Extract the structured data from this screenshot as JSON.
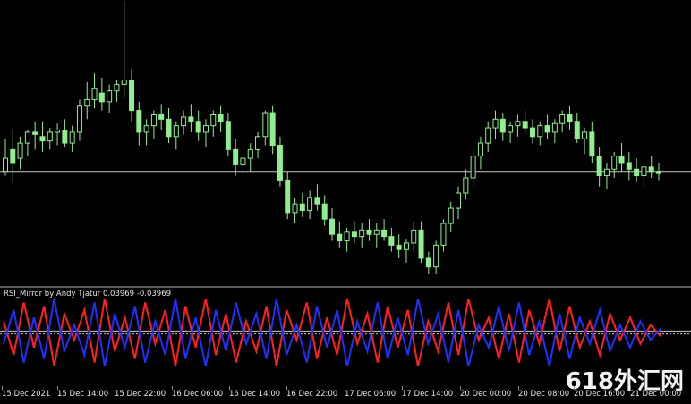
{
  "indicator": {
    "label": "RSI_Mirror by Andy Tjatur 0.03969 -0.03969"
  },
  "time_axis": {
    "labels": [
      "15 Dec 2021",
      "15 Dec 14:00",
      "15 Dec 22:00",
      "16 Dec 06:00",
      "16 Dec 14:00",
      "16 Dec 22:00",
      "17 Dec 06:00",
      "17 Dec 14:00",
      "20 Dec 00:00",
      "20 Dec 08:00",
      "20 Dec 16:00",
      "21 Dec 00:00"
    ]
  },
  "watermark": "618外汇网",
  "colors": {
    "background": "#000000",
    "candle": "#90ee90",
    "rsi_up": "#ff2020",
    "rsi_down": "#2030ff",
    "level_line": "#c8c8c8"
  },
  "chart_data": {
    "type": "candlestick",
    "candles": [
      [
        0.604,
        0.634,
        0.6,
        0.616
      ],
      [
        0.624,
        0.642,
        0.594,
        0.612
      ],
      [
        0.616,
        0.636,
        0.606,
        0.63
      ],
      [
        0.63,
        0.642,
        0.618,
        0.64
      ],
      [
        0.64,
        0.65,
        0.624,
        0.638
      ],
      [
        0.636,
        0.65,
        0.622,
        0.632
      ],
      [
        0.632,
        0.644,
        0.624,
        0.64
      ],
      [
        0.64,
        0.648,
        0.628,
        0.642
      ],
      [
        0.642,
        0.652,
        0.626,
        0.63
      ],
      [
        0.63,
        0.646,
        0.622,
        0.64
      ],
      [
        0.64,
        0.67,
        0.632,
        0.664
      ],
      [
        0.664,
        0.686,
        0.652,
        0.67
      ],
      [
        0.67,
        0.694,
        0.662,
        0.68
      ],
      [
        0.676,
        0.69,
        0.66,
        0.668
      ],
      [
        0.668,
        0.684,
        0.658,
        0.678
      ],
      [
        0.678,
        0.688,
        0.668,
        0.684
      ],
      [
        0.684,
        0.76,
        0.672,
        0.688
      ],
      [
        0.688,
        0.698,
        0.65,
        0.66
      ],
      [
        0.66,
        0.668,
        0.628,
        0.64
      ],
      [
        0.64,
        0.652,
        0.628,
        0.646
      ],
      [
        0.646,
        0.66,
        0.634,
        0.656
      ],
      [
        0.656,
        0.666,
        0.642,
        0.652
      ],
      [
        0.652,
        0.662,
        0.63,
        0.636
      ],
      [
        0.636,
        0.65,
        0.624,
        0.646
      ],
      [
        0.646,
        0.66,
        0.638,
        0.654
      ],
      [
        0.654,
        0.666,
        0.64,
        0.65
      ],
      [
        0.65,
        0.66,
        0.632,
        0.64
      ],
      [
        0.64,
        0.652,
        0.626,
        0.646
      ],
      [
        0.646,
        0.66,
        0.636,
        0.656
      ],
      [
        0.656,
        0.664,
        0.64,
        0.65
      ],
      [
        0.65,
        0.658,
        0.618,
        0.624
      ],
      [
        0.624,
        0.634,
        0.6,
        0.61
      ],
      [
        0.61,
        0.622,
        0.596,
        0.616
      ],
      [
        0.616,
        0.63,
        0.604,
        0.624
      ],
      [
        0.624,
        0.64,
        0.616,
        0.636
      ],
      [
        0.636,
        0.66,
        0.628,
        0.658
      ],
      [
        0.658,
        0.664,
        0.62,
        0.628
      ],
      [
        0.628,
        0.636,
        0.59,
        0.596
      ],
      [
        0.596,
        0.604,
        0.56,
        0.566
      ],
      [
        0.566,
        0.58,
        0.556,
        0.574
      ],
      [
        0.574,
        0.584,
        0.562,
        0.568
      ],
      [
        0.568,
        0.586,
        0.56,
        0.58
      ],
      [
        0.58,
        0.592,
        0.568,
        0.574
      ],
      [
        0.574,
        0.582,
        0.554,
        0.56
      ],
      [
        0.56,
        0.57,
        0.54,
        0.546
      ],
      [
        0.546,
        0.558,
        0.534,
        0.54
      ],
      [
        0.54,
        0.552,
        0.53,
        0.548
      ],
      [
        0.548,
        0.558,
        0.538,
        0.544
      ],
      [
        0.544,
        0.556,
        0.534,
        0.55
      ],
      [
        0.55,
        0.56,
        0.54,
        0.546
      ],
      [
        0.546,
        0.556,
        0.534,
        0.55
      ],
      [
        0.55,
        0.56,
        0.54,
        0.544
      ],
      [
        0.544,
        0.552,
        0.53,
        0.536
      ],
      [
        0.536,
        0.546,
        0.524,
        0.532
      ],
      [
        0.532,
        0.542,
        0.52,
        0.538
      ],
      [
        0.538,
        0.558,
        0.53,
        0.55
      ],
      [
        0.55,
        0.558,
        0.52,
        0.524
      ],
      [
        0.524,
        0.53,
        0.51,
        0.516
      ],
      [
        0.516,
        0.54,
        0.51,
        0.536
      ],
      [
        0.536,
        0.56,
        0.53,
        0.556
      ],
      [
        0.556,
        0.576,
        0.548,
        0.57
      ],
      [
        0.57,
        0.59,
        0.56,
        0.584
      ],
      [
        0.584,
        0.606,
        0.578,
        0.598
      ],
      [
        0.598,
        0.626,
        0.59,
        0.618
      ],
      [
        0.618,
        0.636,
        0.606,
        0.63
      ],
      [
        0.63,
        0.65,
        0.622,
        0.644
      ],
      [
        0.644,
        0.66,
        0.634,
        0.652
      ],
      [
        0.652,
        0.658,
        0.632,
        0.64
      ],
      [
        0.64,
        0.65,
        0.63,
        0.646
      ],
      [
        0.646,
        0.656,
        0.636,
        0.65
      ],
      [
        0.65,
        0.66,
        0.638,
        0.644
      ],
      [
        0.644,
        0.652,
        0.63,
        0.636
      ],
      [
        0.636,
        0.65,
        0.628,
        0.646
      ],
      [
        0.646,
        0.656,
        0.634,
        0.64
      ],
      [
        0.64,
        0.652,
        0.63,
        0.648
      ],
      [
        0.648,
        0.66,
        0.64,
        0.656
      ],
      [
        0.656,
        0.664,
        0.642,
        0.65
      ],
      [
        0.65,
        0.658,
        0.63,
        0.634
      ],
      [
        0.634,
        0.644,
        0.62,
        0.64
      ],
      [
        0.64,
        0.65,
        0.612,
        0.618
      ],
      [
        0.618,
        0.626,
        0.59,
        0.6
      ],
      [
        0.6,
        0.612,
        0.588,
        0.606
      ],
      [
        0.606,
        0.622,
        0.598,
        0.618
      ],
      [
        0.618,
        0.63,
        0.604,
        0.612
      ],
      [
        0.612,
        0.622,
        0.596,
        0.606
      ],
      [
        0.606,
        0.616,
        0.594,
        0.6
      ],
      [
        0.6,
        0.612,
        0.59,
        0.608
      ],
      [
        0.608,
        0.618,
        0.598,
        0.604
      ],
      [
        0.604,
        0.612,
        0.596,
        0.602
      ]
    ],
    "level_line": 0.604,
    "rsi_mirror": {
      "levels": [
        0.03969,
        -0.03969
      ],
      "series": [
        {
          "name": "up",
          "values": [
            0.3,
            -0.6,
            0.8,
            -0.4,
            0.7,
            -0.9,
            0.5,
            -0.2,
            0.6,
            -0.8,
            0.9,
            -0.5,
            0.4,
            -0.7,
            0.8,
            -0.3,
            0.6,
            -0.9,
            0.7,
            -0.4,
            0.9,
            -0.6,
            0.5,
            -0.8,
            0.3,
            -0.5,
            0.7,
            -0.9,
            0.6,
            -0.2,
            0.8,
            -0.7,
            0.4,
            -0.6,
            0.9,
            -0.3,
            0.5,
            -0.8,
            0.7,
            -0.4,
            0.6,
            -0.9,
            0.3,
            -0.5,
            0.8,
            -0.6,
            0.9,
            -0.2,
            0.4,
            -0.7,
            0.5,
            -0.8,
            0.6,
            -0.3,
            0.9,
            -0.5,
            0.7,
            -0.4,
            0.3,
            -0.6,
            0.5,
            -0.2,
            0.4,
            -0.3,
            0.2,
            -0.1
          ]
        },
        {
          "name": "down",
          "values": [
            -0.3,
            0.6,
            -0.8,
            0.4,
            -0.7,
            0.9,
            -0.5,
            0.2,
            -0.6,
            0.8,
            -0.9,
            0.5,
            -0.4,
            0.7,
            -0.8,
            0.3,
            -0.6,
            0.9,
            -0.7,
            0.4,
            -0.9,
            0.6,
            -0.5,
            0.8,
            -0.3,
            0.5,
            -0.7,
            0.9,
            -0.6,
            0.2,
            -0.8,
            0.7,
            -0.4,
            0.6,
            -0.9,
            0.3,
            -0.5,
            0.8,
            -0.7,
            0.4,
            -0.6,
            0.9,
            -0.3,
            0.5,
            -0.8,
            0.6,
            -0.9,
            0.2,
            -0.4,
            0.7,
            -0.5,
            0.8,
            -0.6,
            0.3,
            -0.9,
            0.5,
            -0.7,
            0.4,
            -0.3,
            0.6,
            -0.5,
            0.2,
            -0.4,
            0.3,
            -0.2,
            0.1
          ]
        }
      ]
    }
  }
}
